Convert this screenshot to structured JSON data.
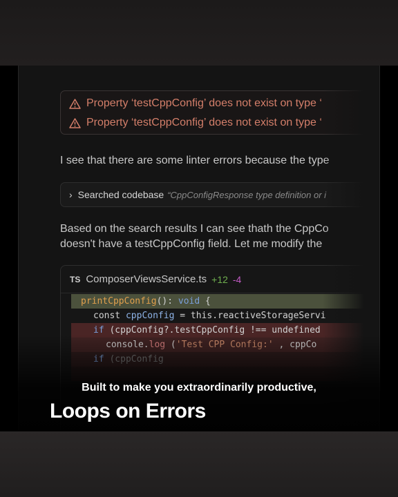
{
  "errors": [
    "Property ‘testCppConfig’ does not exist on type ‘",
    "Property ‘testCppConfig’ does not exist on type ‘"
  ],
  "paragraph1": "I see that there are some linter errors because the type",
  "search": {
    "label": "Searched codebase",
    "query": "“CppConfigResponse type definition or i"
  },
  "paragraph2": {
    "line1": "Based on the search results I can see thath the CppCo",
    "line2": "doesn't have a testCppConfig field. Let me modify the"
  },
  "code": {
    "lang_badge": "TS",
    "filename": "ComposerViewsService.ts",
    "added": "+12",
    "removed": "-4",
    "lines": [
      {
        "fn": "printCppConfig",
        "paren": "(): ",
        "kw": "void",
        "rest": " {"
      },
      {
        "kw": "const ",
        "var": "cppConfig",
        "rest": " = this.reactiveStorageServi"
      },
      {
        "kw": "if ",
        "rest": "(cppConfig?.testCppConfig !== undefined"
      },
      {
        "obj": "console.",
        "method": "log",
        "rest": " (",
        "str": "'Test CPP Config:'",
        "rest2": " , cppCo"
      },
      {
        "kw": "if ",
        "rest": "(cppConfig"
      },
      {
        "rest": ""
      }
    ]
  },
  "caption": {
    "subtitle": "Built to make you extraordinarily productive,",
    "title": "Loops on Errors"
  }
}
